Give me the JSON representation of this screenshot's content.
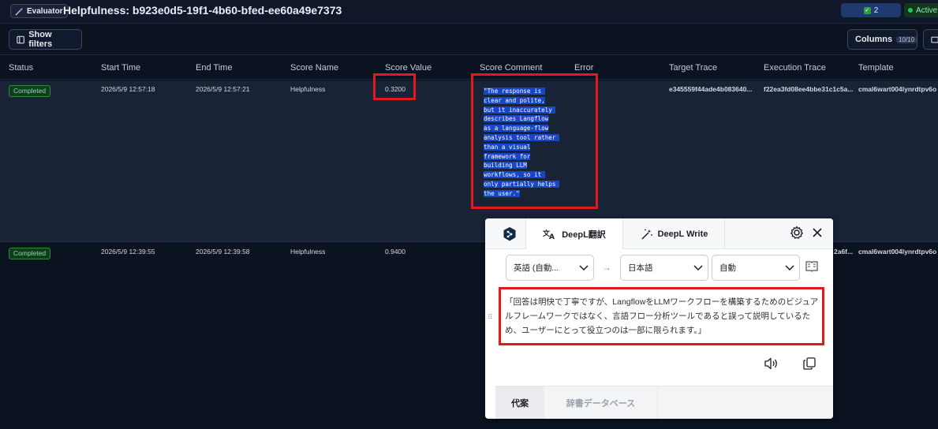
{
  "header": {
    "badge_label": "Evaluator",
    "title": "Helpfulness: b923e0d5-19f1-4b60-bfed-ee60a49e7373",
    "count_label": "2",
    "status_label": "Active"
  },
  "toolbar": {
    "filters_label": "Show filters",
    "columns_label": "Columns",
    "columns_count": "10/10"
  },
  "table": {
    "columns": [
      "Status",
      "Start Time",
      "End Time",
      "Score Name",
      "Score Value",
      "Score Comment",
      "Error",
      "Target Trace",
      "Execution Trace",
      "Template"
    ],
    "rows": [
      {
        "status": "Completed",
        "start_time": "2026/5/9 12:57:18",
        "end_time": "2026/5/9 12:57:21",
        "score_name": "Helpfulness",
        "score_value": "0.3200",
        "comment_lines": [
          "\"The response is ",
          "clear and polite,",
          "but it inaccurately ",
          "describes Langflow",
          "as a language-flow",
          "analysis tool rather ",
          "than a visual",
          "framework for",
          "building LLM",
          "workflows, so it ",
          "only partially helps ",
          "the user.\""
        ],
        "target_trace": "e345559f44ade4b083640...",
        "execution_trace": "f22ea3fd08ee4bbe31c1c5a...",
        "template": "cmal6wart004lynrdtpv6o"
      },
      {
        "status": "Completed",
        "start_time": "2026/5/9 12:39:55",
        "end_time": "2026/5/9 12:39:58",
        "score_name": "Helpfulness",
        "score_value": "0.9400",
        "execution_trace": "2a6f...",
        "template": "cmal6wart004lynrdtpv6o"
      }
    ]
  },
  "deepl": {
    "tab_translate": "DeepL翻訳",
    "tab_write": "DeepL Write",
    "source_lang": "英語 (自動...",
    "target_lang": "日本語",
    "formality": "自動",
    "arrow": "→",
    "translation": "「回答は明快で丁寧ですが、LangflowをLLMワークフローを構築するためのビジュアルフレームワークではなく、言語フロー分析ツールであると誤って説明しているため、ユーザーにとって役立つのは一部に限られます。」",
    "bottom_tab_alternatives": "代案",
    "bottom_tab_dictionary": "辞書データベース"
  },
  "colors": {
    "highlight": "#e11b1b",
    "accent_blue": "#1746c7",
    "status_green": "#7ee2a0"
  }
}
